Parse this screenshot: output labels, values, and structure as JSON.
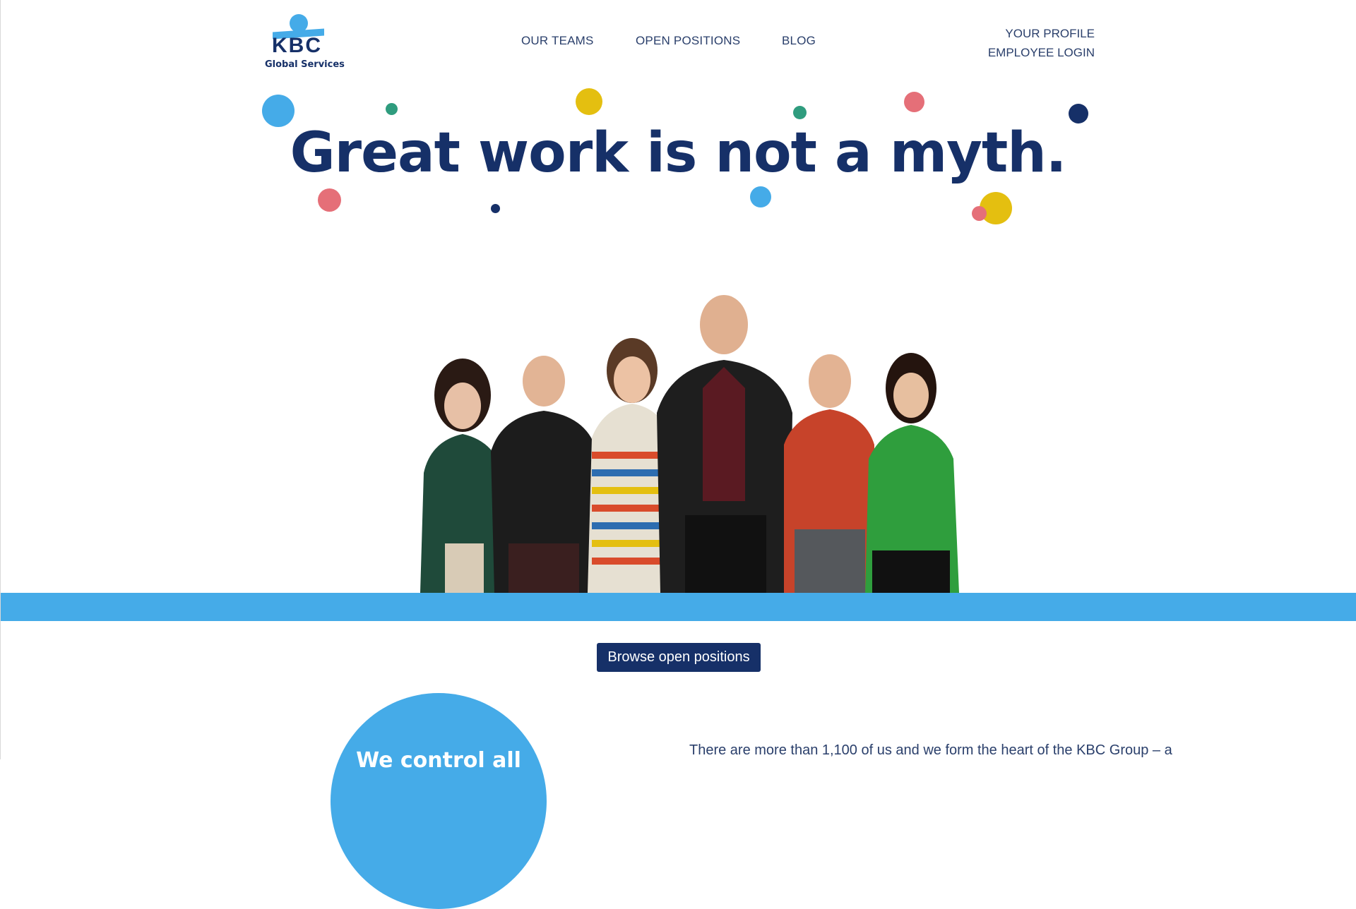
{
  "logo": {
    "mark": "KBC",
    "subtitle": "Global Services"
  },
  "nav": {
    "our_teams": "OUR TEAMS",
    "open_positions": "OPEN POSITIONS",
    "blog": "BLOG",
    "your_profile": "YOUR PROFILE",
    "employee_login": "EMPLOYEE LOGIN"
  },
  "hero": {
    "headline": "Great work is not a myth."
  },
  "cta": {
    "browse_label": "Browse open positions"
  },
  "feature": {
    "circle_text": "We control all"
  },
  "intro": {
    "text": "There are more than 1,100 of us and we form the heart of the KBC Group – a"
  },
  "colors": {
    "navy": "#163068",
    "blue": "#45abe8",
    "yellow": "#e4bf10",
    "pink": "#e56f78",
    "teal": "#2f9c7e"
  }
}
